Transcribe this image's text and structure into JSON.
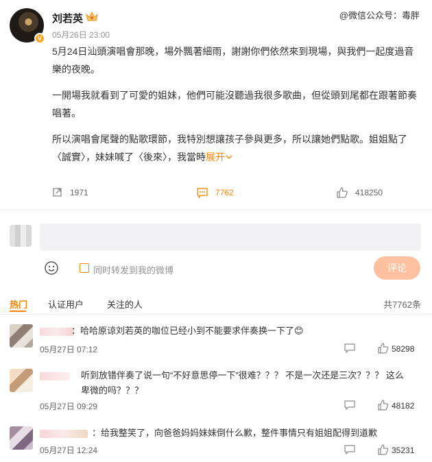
{
  "watermark": "@微信公众号：毒胖",
  "post": {
    "author": "刘若英",
    "time": "05月26日 23:00",
    "paragraphs": [
      "5月24日汕頭演唱會那晚，場外飄著細雨，謝謝你們依然來到現場，與我們一起度過音樂的夜晚。",
      "一開場我就看到了可愛的姐妹，他們可能沒聽過我很多歌曲，但從頭到尾都在跟著節奏唱著。",
      "所以演唱會尾聲的點歌環節，我特別想讓孩子參與更多，所以讓她們點歌。姐姐點了〈誠實〉，妹妹喊了〈後來〉，我當時"
    ],
    "expand_label": "展开",
    "reposts": "1971",
    "comments": "7762",
    "likes": "418250"
  },
  "composer": {
    "repost_label": "同时转发到我的微博",
    "submit_label": "评论"
  },
  "tabs": [
    {
      "label": "热门"
    },
    {
      "label": "认证用户"
    },
    {
      "label": "关注的人"
    }
  ],
  "total_label": "共7762条",
  "comments": [
    {
      "text": "：哈哈原谅刘若英的咖位已经小到不能要求伴奏换一下了😊",
      "time": "05月27日 07:12",
      "likes": "58298"
    },
    {
      "text": "听到放错伴奏了说一句“不好意思停一下”很难？？？ 不是一次还是三次？？？ 这么卑微的吗？？？",
      "time": "05月27日 09:29",
      "likes": "48182"
    },
    {
      "text": "：给我整笑了，向爸爸妈妈妹妹倒什么歉，整件事情只有姐姐配得到道歉",
      "time": "05月27日 12:24",
      "likes": "35231"
    }
  ],
  "colors": {
    "accent": "#ff8200",
    "submit_disabled": "#ffc09f"
  }
}
